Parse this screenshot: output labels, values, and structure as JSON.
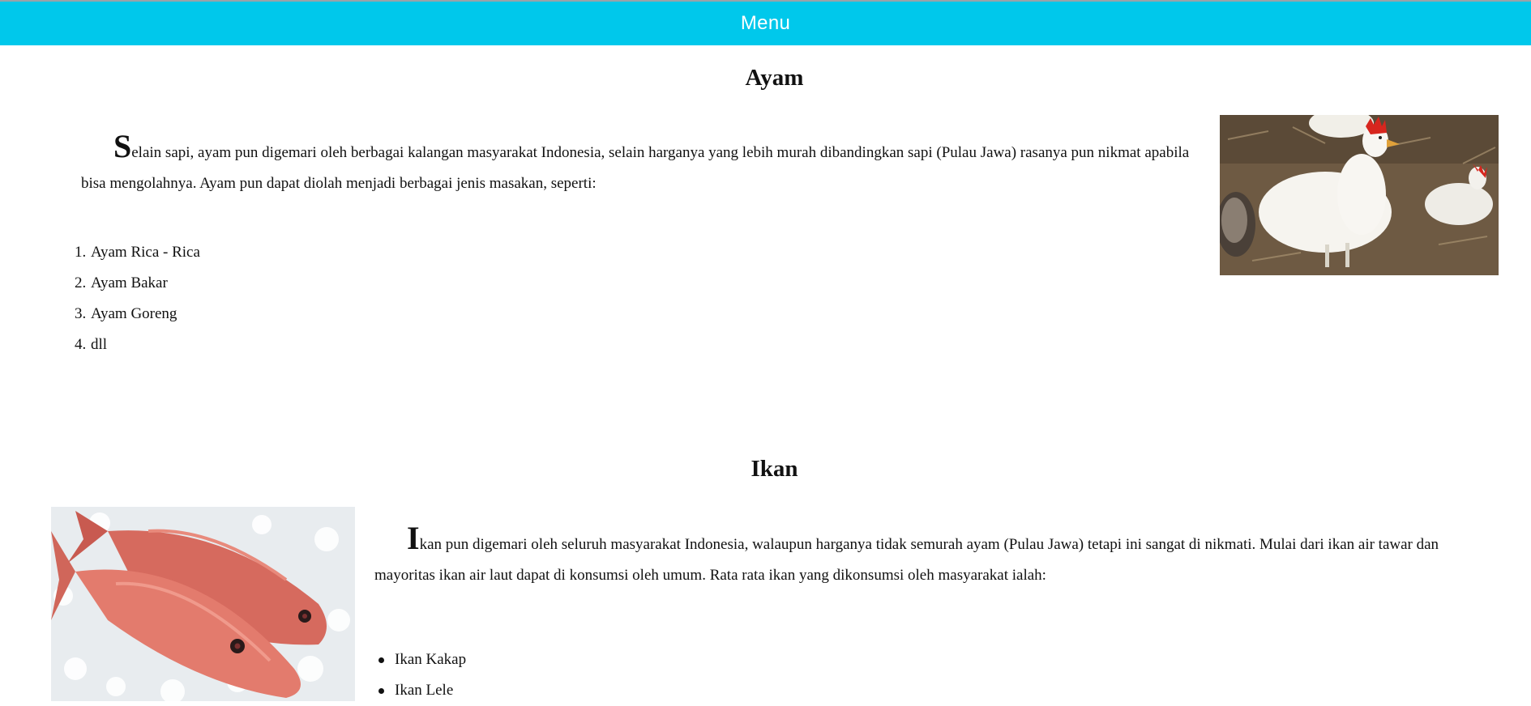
{
  "nav": {
    "menu_label": "Menu"
  },
  "sections": [
    {
      "title": "Ayam",
      "dropcap": "S",
      "paragraph": "elain sapi, ayam pun digemari oleh berbagai kalangan masyarakat Indonesia, selain harganya yang lebih murah dibandingkan sapi (Pulau Jawa) rasanya pun nikmat apabila bisa mengolahnya. Ayam pun dapat diolah menjadi berbagai jenis masakan, seperti:",
      "list_style": "ordered",
      "items": [
        "Ayam Rica - Rica",
        "Ayam Bakar",
        "Ayam Goreng",
        "dll"
      ],
      "image": "chicken-photo"
    },
    {
      "title": "Ikan",
      "dropcap": "I",
      "paragraph": "kan pun digemari oleh seluruh masyarakat Indonesia, walaupun harganya tidak semurah ayam (Pulau Jawa) tetapi ini sangat di nikmati. Mulai dari ikan air tawar dan mayoritas ikan air laut dapat di konsumsi oleh umum. Rata rata ikan yang dikonsumsi oleh masyarakat ialah:",
      "list_style": "unordered",
      "items": [
        "Ikan Kakap",
        "Ikan Lele"
      ],
      "image": "fish-photo"
    }
  ],
  "colors": {
    "menu_bar": "#00c8eb",
    "menu_text": "#ffffff",
    "text": "#111111"
  }
}
